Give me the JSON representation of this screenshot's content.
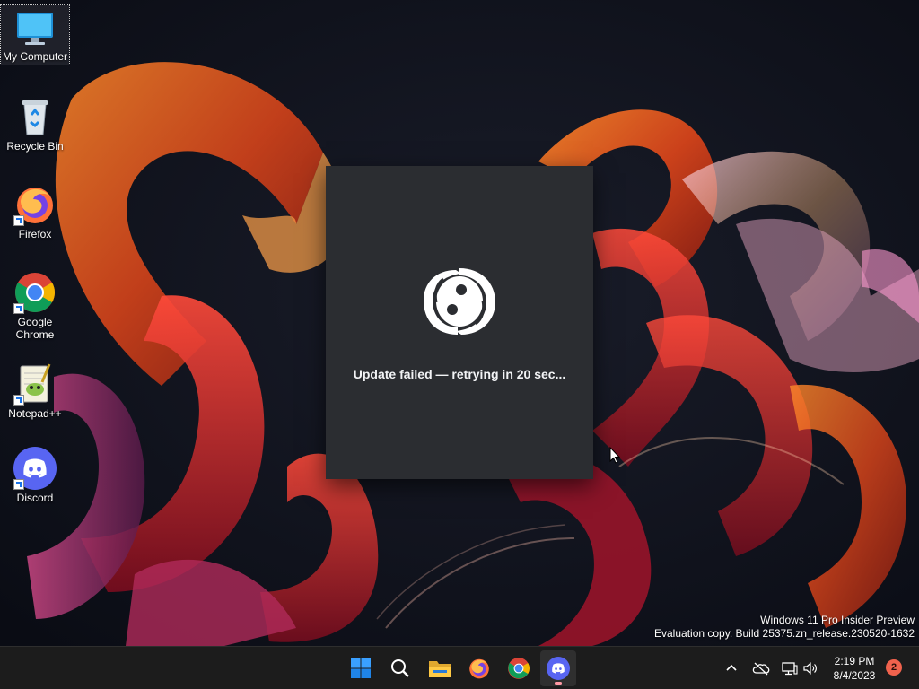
{
  "desktop": {
    "icons": [
      {
        "label": "My Computer",
        "icon": "monitor-icon"
      },
      {
        "label": "Recycle Bin",
        "icon": "recycle-bin-icon"
      },
      {
        "label": "Firefox",
        "icon": "firefox-icon"
      },
      {
        "label": "Google Chrome",
        "icon": "chrome-icon"
      },
      {
        "label": "Notepad++",
        "icon": "notepadpp-icon"
      },
      {
        "label": "Discord",
        "icon": "discord-icon"
      }
    ],
    "watermark": {
      "line1": "Windows 11 Pro Insider Preview",
      "line2": "Evaluation copy. Build 25375.zn_release.230520-1632"
    }
  },
  "dialog": {
    "status": "Update failed — retrying in 20 sec...",
    "background": "#2b2d31"
  },
  "taskbar": {
    "apps": [
      "start-icon",
      "search-icon",
      "file-explorer-icon",
      "firefox-icon",
      "chrome-icon",
      "discord-icon"
    ],
    "active_app": "discord",
    "tray": {
      "time": "2:19 PM",
      "date": "8/4/2023",
      "notification_count": "2"
    }
  },
  "colors": {
    "discord_blurple": "#5865f2",
    "taskbar": "#1c1c1c",
    "notification_badge": "#f0624d"
  }
}
